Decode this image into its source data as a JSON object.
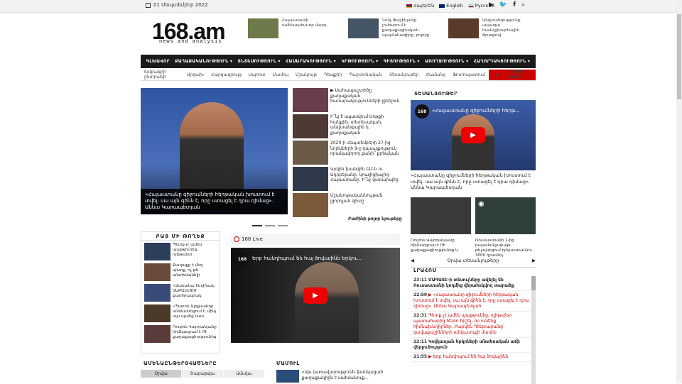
{
  "topbar": {
    "date": "01 Սեպտեմբեր 2022",
    "langs": [
      {
        "label": "Հայերեն",
        "color": "#d90012"
      },
      {
        "label": "English",
        "color": "#012169"
      },
      {
        "label": "Русский",
        "color": "#0039a6"
      }
    ],
    "social": [
      "youtube-icon",
      "twitter-icon",
      "facebook-icon",
      "search-icon"
    ]
  },
  "header": {
    "logo": "168.am",
    "tagline": "news and analysis",
    "news": [
      {
        "text": "Հայաստանի ամենաահաւոր մարդ",
        "color": "#6d7a4a"
      },
      {
        "text": "Նոնչ Փաշինյանը լուծարում է քաղաքացիական պայմանագիրը. բոլորը՝",
        "color": "#445566"
      },
      {
        "text": "Անվտանգությունը՝ ապագա համաշխարհային ծրագրով",
        "color": "#5a3a2a"
      }
    ]
  },
  "mainnav": [
    "ԳԼԽԱՎՈՐ",
    "ՔԱՂԱՔԱԿԱՆՈՒԹՅՈՒՆ ▾",
    "ՏՆՏԵՍՈՒԹՅՈՒՆ ▾",
    "ՀԱՍԱՐԱԿՈՒԹՅՈՒՆ ▾",
    "ԿՐԹՈՒԹՅՈՒՆ ▾",
    "ԳԻՏՈՒԹՅՈՒՆ ▾",
    "ԱՌՈՂՋՈՒԹՅՈՒՆ ▾",
    "ՀԱՂՈՐԴԱԿՑՈՒԹՅՈՒՆ ▾"
  ],
  "subnav": [
    "Խմբագրի ընտրանի",
    "Արցախ",
    "Հարցազրույց",
    "Սպորտ",
    "Մամուլ",
    "Մշակույթ",
    "Դեպքեր",
    "Պաշտոնական",
    "Տեսանյութեր",
    "Ժամանց",
    "Ֆոտոպատում"
  ],
  "live_btn": "ՈՒՂԻՂ ԵԹԵՐ",
  "hero": {
    "caption": "«Հայաստանը զիջումների հերթական խոստում է տվել. սա այն գինն է, որը ստացել է դրա դիմաց». Աննա Կարապետյան"
  },
  "news": [
    {
      "text": "Սահապաշտիծը քաղաքական հասարակությունների լցնելուն",
      "video": true,
      "color": "#6a3d4a"
    },
    {
      "text": "Ի՞նչ է սպասվում Սոթքի հանքին․ տնտեսական, անվտանգային և քաղաքական",
      "video": false,
      "color": "#4d3a32"
    },
    {
      "text": "2020-ի սեպտեմբերի 27-ից նոյեմբերի 9-ը դասալքություն որակավորող քանի՞ քրեական",
      "video": false,
      "color": "#6c5a48"
    },
    {
      "text": "Կրկին խանգին ԵՄ-ն ու Ադրբեջանը, կոալիցիայից Հայաստանը. Ի՞նչ կստարպեց",
      "video": false,
      "color": "#2e3a4a"
    },
    {
      "text": "Մշակութականնույթան լցորդյան գիտը",
      "video": false,
      "color": "#7a5a3a"
    }
  ],
  "more": "Բաժինի բոլոր նյութերը",
  "videos_head": "ՏԵՍԱՆՅՈՒԹԵՐ",
  "video1": {
    "title": "«Հայաստանը զիջումների հերթ...",
    "caption": "«Հայաստանը զիջումների հերթական խոստում է տվել. սա այն գինն է, որը ստացել է դրա դիմաց». Աննա Կարապետյան"
  },
  "smalls": [
    {
      "text": "Ռուբեն Վարդանյանը հիմնադրամ է ՈՒ քաղաքացիությունից և",
      "color": "#3a3a3a"
    },
    {
      "text": "Ռուսաստանի 1-ից բալամանշաբաթ թելայնեցում երկաստաննու 3000 դրամով.",
      "color": "#2f3f3a"
    }
  ],
  "pager": "Օրվա տեսանյութերը",
  "lrahos": {
    "title": "ԼՐԱՀՈՍ",
    "items": [
      {
        "time": "23:11",
        "text": "ՄԱԳԱՏԷ-ի տեսուչները ավելել են Ռուսաստանի կողմից վերահսկվող տարածք",
        "red": false,
        "video": false
      },
      {
        "time": "22:50",
        "text": "«Հայաստանը զիջումների հերթական խոստում է տվել. սա այն գինն է, որը ստացել է դրա դիմաց». Աննա Կարապետյան",
        "red": true,
        "video": true
      },
      {
        "time": "22:31",
        "text": "Պետք չէ ամեն պայթյունից, ոչիթանտ պատահարից հետո հիշել, որ ունենք հիմնախնդիրներ. Բաբկեն Դեկտարանց` զավաքաշինների անկասուքի մասին",
        "red": true,
        "video": false
      },
      {
        "time": "22:11",
        "text": "Կովկասյան երկրների տնտեսական աճի վերլուծություն",
        "red": false,
        "video": false
      },
      {
        "time": "21:55",
        "text": "Երբ հանդիպում են հայ ծովայինն",
        "red": true,
        "video": true
      }
    ]
  },
  "bmt": {
    "title": "ԲԱՑ ՄԻ ԹՈՂԵՔ",
    "items": [
      {
        "text": "Պետք չէ ամեն պայթյունից, ոչիթանտ",
        "color": "#2d3e5a"
      },
      {
        "text": "Քաղաքը է մեզ պետք, ոչ թե անտեսանելի",
        "color": "#6a4a3a"
      },
      {
        "text": "«Զառանա հեղինակ ՉԱԲԱԼԵՑՈՒ քարծրագրակ",
        "color": "#3a4a7a"
      },
      {
        "text": "«Պարոն Ալեքսանդր անձնանեցում է, մինչ այս պահը նաև",
        "color": "#4a3a2a"
      },
      {
        "text": "Ռուբեն Վարդանյանը հիմնադրամ է ՈՒ քաղաքացիությունից",
        "color": "#5a3a3a"
      }
    ]
  },
  "live": {
    "label": "168 Live"
  },
  "video2": {
    "title": "Երբ հանդիպում են հայ ծովայինն Երկու..."
  },
  "most": {
    "title": "ԱՄԵՆԱԸՆԹԵՐՑՎԱԾՆԵՐԸ",
    "tabs": [
      "Օրվա",
      "Շաբաթվա",
      "Ամսվա"
    ]
  },
  "mamul": {
    "title": "ՄԱՄՈՒԼ",
    "text": "«Այս կառավարությունն ֆանկացած քաղաքակիցն է սահմանուք..."
  },
  "colors": {
    "nav": "#1a1a1a",
    "accent": "#cc0000"
  }
}
